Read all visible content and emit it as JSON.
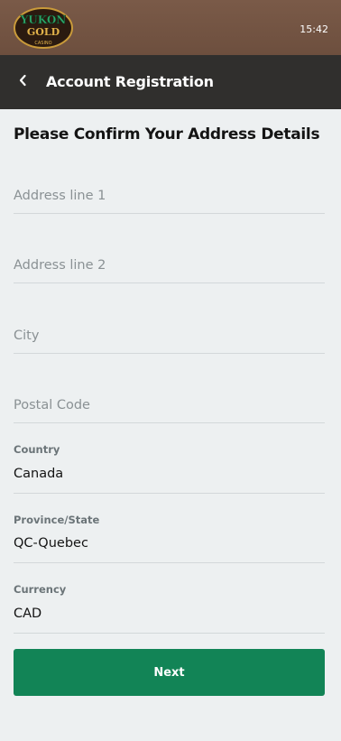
{
  "status_bar": {
    "time": "15:42"
  },
  "logo": {
    "line1": "YUKON",
    "line2": "GOLD",
    "line3": "CASINO"
  },
  "header": {
    "title": "Account Registration"
  },
  "form": {
    "heading": "Please Confirm Your Address Details",
    "address1": {
      "placeholder": "Address line 1",
      "value": ""
    },
    "address2": {
      "placeholder": "Address line 2",
      "value": ""
    },
    "city": {
      "placeholder": "City",
      "value": ""
    },
    "postal": {
      "placeholder": "Postal Code",
      "value": ""
    },
    "country": {
      "label": "Country",
      "value": "Canada"
    },
    "province": {
      "label": "Province/State",
      "value": "QC-Quebec"
    },
    "currency": {
      "label": "Currency",
      "value": "CAD"
    },
    "next_label": "Next"
  },
  "colors": {
    "top_bar": "#7a5a48",
    "header": "#302f2d",
    "background": "#edf0f1",
    "accent": "#128456"
  }
}
